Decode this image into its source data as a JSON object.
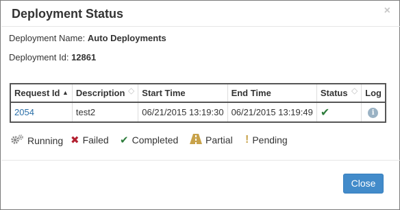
{
  "dialog": {
    "title": "Deployment Status",
    "close_symbol": "×"
  },
  "info": {
    "name_label": "Deployment Name:",
    "name_value": "Auto Deployments",
    "id_label": "Deployment Id:",
    "id_value": "12861"
  },
  "table": {
    "columns": [
      "Request Id",
      "Description",
      "Start Time",
      "End Time",
      "Status",
      "Log"
    ],
    "rows": [
      {
        "request_id": "2054",
        "description": "test2",
        "start_time": "06/21/2015 13:19:30",
        "end_time": "06/21/2015 13:19:49",
        "status": "Completed",
        "status_icon": "check-icon",
        "log_icon": "info-icon"
      }
    ]
  },
  "legend": [
    {
      "label": "Running",
      "icon": "gears-icon"
    },
    {
      "label": "Failed",
      "icon": "x-icon"
    },
    {
      "label": "Completed",
      "icon": "check-icon"
    },
    {
      "label": "Partial",
      "icon": "road-icon"
    },
    {
      "label": "Pending",
      "icon": "exclamation-icon"
    }
  ],
  "footer": {
    "close_label": "Close"
  },
  "colors": {
    "primary": "#428bca",
    "success": "#2e7d3c",
    "danger": "#b32030",
    "warning": "#c8a24a",
    "link": "#2a6fa8"
  }
}
